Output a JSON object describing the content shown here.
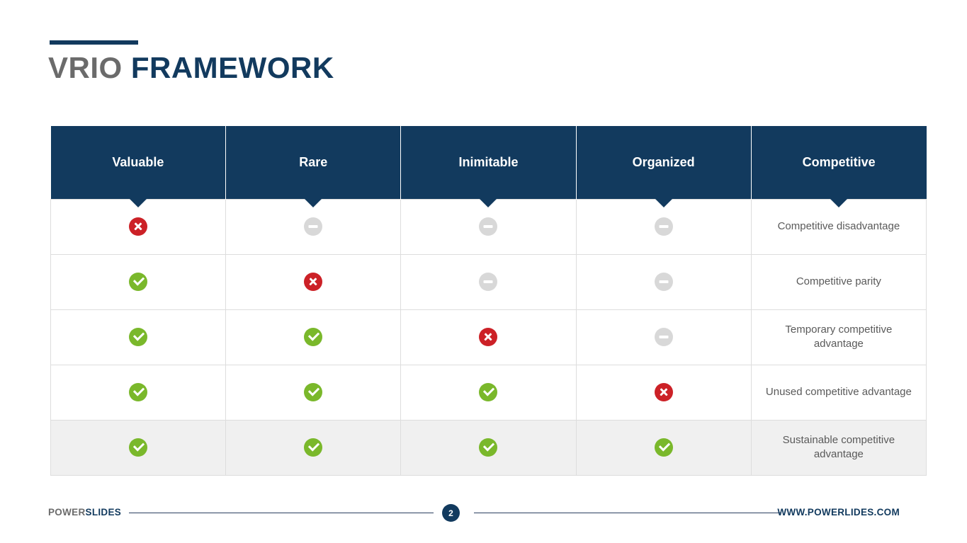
{
  "title": {
    "part_a": "VRIO ",
    "part_b": "FRAMEWORK",
    "accent_color": "#123A5E",
    "part_a_color": "#6B6B6B",
    "part_b_color": "#123A5E"
  },
  "table": {
    "header_bg": "#123A5E",
    "headers": [
      {
        "label": "Valuable"
      },
      {
        "label": "Rare"
      },
      {
        "label": "Inimitable"
      },
      {
        "label": "Organized"
      },
      {
        "label": "Competitive"
      }
    ],
    "icon_colors": {
      "yes": "#7AB82B",
      "no": "#CC2127",
      "na": "#D8D8D8"
    },
    "rows": [
      {
        "valuable": "no",
        "rare": "na",
        "inimitable": "na",
        "organized": "na",
        "outcome": "Competitive disadvantage",
        "highlight": false
      },
      {
        "valuable": "yes",
        "rare": "no",
        "inimitable": "na",
        "organized": "na",
        "outcome": "Competitive parity",
        "highlight": false
      },
      {
        "valuable": "yes",
        "rare": "yes",
        "inimitable": "no",
        "organized": "na",
        "outcome": "Temporary competitive advantage",
        "highlight": false
      },
      {
        "valuable": "yes",
        "rare": "yes",
        "inimitable": "yes",
        "organized": "no",
        "outcome": "Unused competitive advantage",
        "highlight": false
      },
      {
        "valuable": "yes",
        "rare": "yes",
        "inimitable": "yes",
        "organized": "yes",
        "outcome": "Sustainable competitive advantage",
        "highlight": true
      }
    ]
  },
  "footer": {
    "brand_a": "POWER",
    "brand_b": "SLIDES",
    "page_number": "2",
    "url": "WWW.POWERLIDES.COM"
  }
}
